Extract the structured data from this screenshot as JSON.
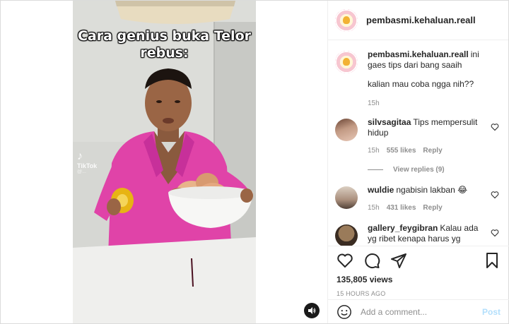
{
  "post": {
    "username": "pembasmi.kehaluan.reall",
    "caption_line1": "ini gaes tips dari bang saaih",
    "caption_line2": "kalian mau coba ngga nih??",
    "caption_time": "15h"
  },
  "video": {
    "overlay_line1": "Cara genius buka Telor",
    "overlay_line2": "rebus:",
    "watermark": "TikTok",
    "watermark_handle": "@...",
    "audio_icon": "speaker-icon"
  },
  "comments": [
    {
      "user": "silvsagitaa",
      "text": "Tips mempersulit hidup",
      "time": "15h",
      "likes": "555 likes",
      "reply": "Reply",
      "view_replies": "View replies (9)"
    },
    {
      "user": "wuldie",
      "text": "ngabisin lakban 😂",
      "time": "15h",
      "likes": "431 likes",
      "reply": "Reply"
    },
    {
      "user": "gallery_feygibran",
      "text": "Kalau ada yg ribet kenapa harus yg mudah"
    }
  ],
  "actions": {
    "icons": [
      "heart-icon",
      "comment-icon",
      "share-icon",
      "bookmark-icon"
    ],
    "views": "135,805 views",
    "posted_ago": "15 HOURS AGO"
  },
  "comment_box": {
    "placeholder": "Add a comment...",
    "post_label": "Post"
  },
  "colors": {
    "accent": "#0095f6",
    "muted": "#8e8e8e",
    "post_disabled": "#b2dffc",
    "robe": "#e040a8"
  }
}
